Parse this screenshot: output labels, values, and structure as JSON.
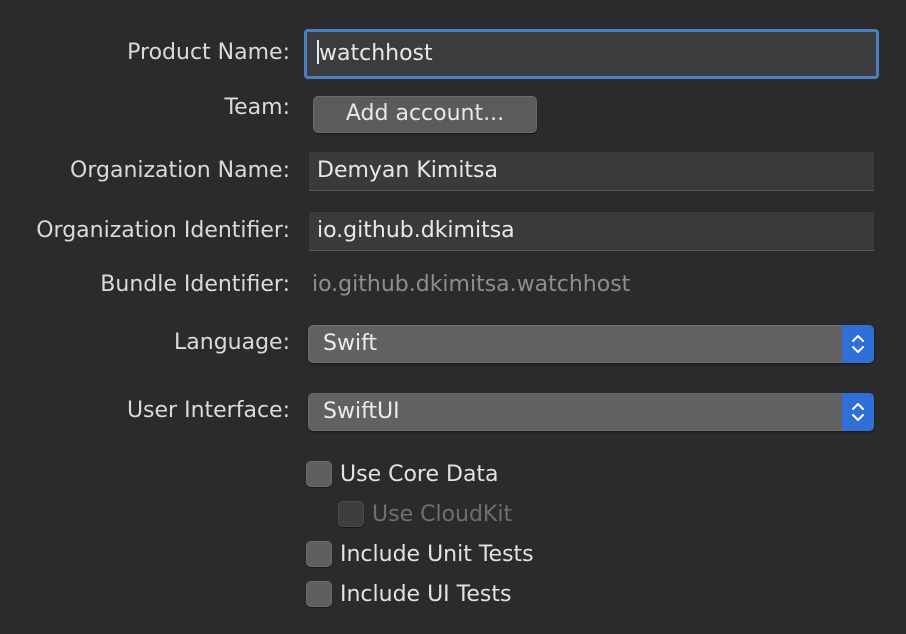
{
  "form": {
    "product_name": {
      "label": "Product Name:",
      "value": "watchhost"
    },
    "team": {
      "label": "Team:",
      "button_label": "Add account..."
    },
    "organization_name": {
      "label": "Organization Name:",
      "value": "Demyan Kimitsa"
    },
    "organization_identifier": {
      "label": "Organization Identifier:",
      "value": "io.github.dkimitsa"
    },
    "bundle_identifier": {
      "label": "Bundle Identifier:",
      "value": "io.github.dkimitsa.watchhost"
    },
    "language": {
      "label": "Language:",
      "selected": "Swift",
      "icon": "chevron-up-down-icon"
    },
    "user_interface": {
      "label": "User Interface:",
      "selected": "SwiftUI",
      "icon": "chevron-up-down-icon"
    }
  },
  "options": {
    "use_core_data": {
      "label": "Use Core Data",
      "checked": false,
      "enabled": true
    },
    "use_cloudkit": {
      "label": "Use CloudKit",
      "checked": false,
      "enabled": false
    },
    "include_unit_tests": {
      "label": "Include Unit Tests",
      "checked": false,
      "enabled": true
    },
    "include_ui_tests": {
      "label": "Include UI Tests",
      "checked": false,
      "enabled": true
    }
  },
  "colors": {
    "background": "#2b2b2d",
    "focus_ring": "#4a80c0",
    "popup_accent": "#2f6fd6"
  }
}
